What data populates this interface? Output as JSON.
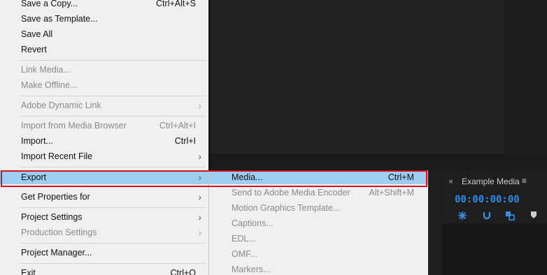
{
  "file_menu": {
    "items": [
      {
        "label": "Save a Copy...",
        "shortcut": "Ctrl+Alt+S",
        "disabled": false
      },
      {
        "label": "Save as Template...",
        "shortcut": "",
        "disabled": false
      },
      {
        "label": "Save All",
        "shortcut": "",
        "disabled": false
      },
      {
        "label": "Revert",
        "shortcut": "",
        "disabled": false
      },
      {
        "label": "Link Media...",
        "shortcut": "",
        "disabled": true
      },
      {
        "label": "Make Offline...",
        "shortcut": "",
        "disabled": true
      },
      {
        "label": "Adobe Dynamic Link",
        "shortcut": "",
        "disabled": true,
        "submenu": true
      },
      {
        "label": "Import from Media Browser",
        "shortcut": "Ctrl+Alt+I",
        "disabled": true
      },
      {
        "label": "Import...",
        "shortcut": "Ctrl+I",
        "disabled": false
      },
      {
        "label": "Import Recent File",
        "shortcut": "",
        "disabled": false,
        "submenu": true
      },
      {
        "label": "Export",
        "shortcut": "",
        "disabled": false,
        "submenu": true,
        "highlighted": true
      },
      {
        "label": "Get Properties for",
        "shortcut": "",
        "disabled": false,
        "submenu": true
      },
      {
        "label": "Project Settings",
        "shortcut": "",
        "disabled": false,
        "submenu": true
      },
      {
        "label": "Production Settings",
        "shortcut": "",
        "disabled": true,
        "submenu": true
      },
      {
        "label": "Project Manager...",
        "shortcut": "",
        "disabled": false
      },
      {
        "label": "Exit",
        "shortcut": "Ctrl+Q",
        "disabled": false
      }
    ]
  },
  "export_submenu": {
    "items": [
      {
        "label": "Media...",
        "shortcut": "Ctrl+M",
        "active": true
      },
      {
        "label": "Send to Adobe Media Encoder",
        "shortcut": "Alt+Shift+M",
        "active": false
      },
      {
        "label": "Motion Graphics Template...",
        "shortcut": "",
        "active": false
      },
      {
        "label": "Captions...",
        "shortcut": "",
        "active": false
      },
      {
        "label": "EDL...",
        "shortcut": "",
        "active": false
      },
      {
        "label": "OMF...",
        "shortcut": "",
        "active": false
      },
      {
        "label": "Markers...",
        "shortcut": "",
        "active": false
      }
    ]
  },
  "timeline_panel": {
    "close_icon": "×",
    "title": "Example Media",
    "menu_icon": "≡",
    "timecode": "00:00:00:00"
  },
  "colors": {
    "highlight": "#9dcdf1",
    "annotation_box": "#d2141e",
    "timecode": "#2d8ceb"
  }
}
